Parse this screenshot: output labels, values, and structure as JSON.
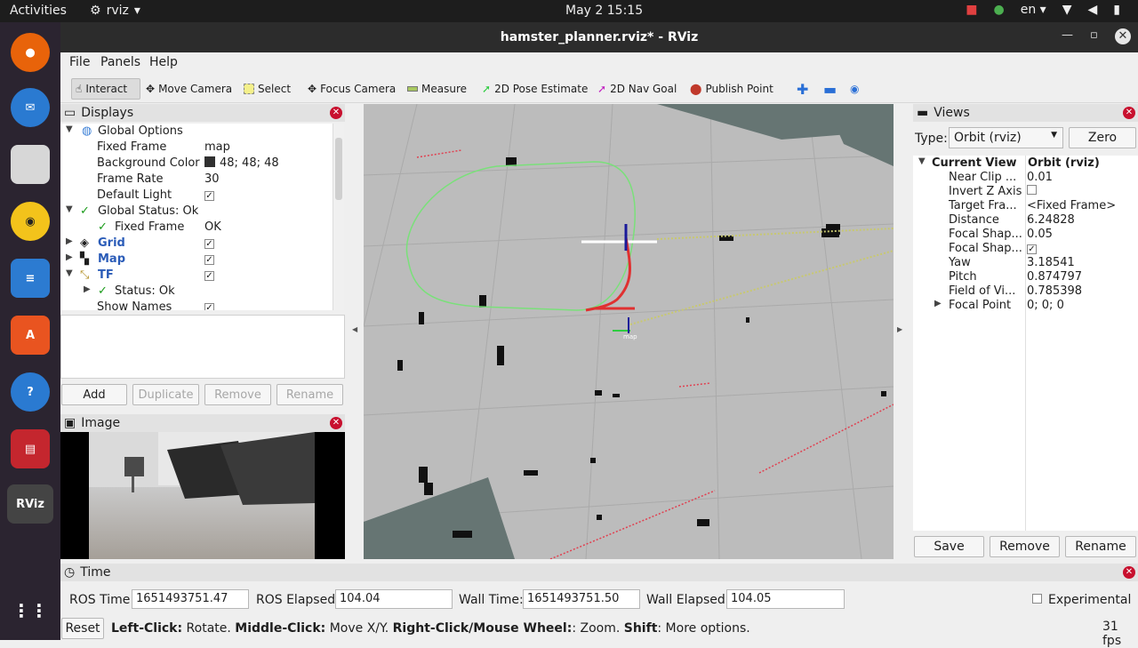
{
  "topbar": {
    "activities": "Activities",
    "app_name": "rviz",
    "clock": "May 2  15:15",
    "lang": "en"
  },
  "window": {
    "title": "hamster_planner.rviz* - RViz"
  },
  "menu": {
    "file": "File",
    "panels": "Panels",
    "help": "Help"
  },
  "toolbar": {
    "interact": "Interact",
    "move_camera": "Move Camera",
    "select": "Select",
    "focus_camera": "Focus Camera",
    "measure": "Measure",
    "pose_estimate": "2D Pose Estimate",
    "nav_goal": "2D Nav Goal",
    "publish_point": "Publish Point"
  },
  "displays": {
    "title": "Displays",
    "rows": [
      {
        "label": "Global Options",
        "value": ""
      },
      {
        "label": "Fixed Frame",
        "value": "map"
      },
      {
        "label": "Background Color",
        "value": "48; 48; 48"
      },
      {
        "label": "Frame Rate",
        "value": "30"
      },
      {
        "label": "Default Light",
        "value": ""
      },
      {
        "label": "Global Status: Ok",
        "value": ""
      },
      {
        "label": "Fixed Frame",
        "value": "OK"
      },
      {
        "label": "Grid",
        "value": ""
      },
      {
        "label": "Map",
        "value": ""
      },
      {
        "label": "TF",
        "value": ""
      },
      {
        "label": "Status: Ok",
        "value": ""
      },
      {
        "label": "Show Names",
        "value": ""
      }
    ],
    "buttons": {
      "add": "Add",
      "duplicate": "Duplicate",
      "remove": "Remove",
      "rename": "Rename"
    }
  },
  "image_panel": {
    "title": "Image"
  },
  "views": {
    "title": "Views",
    "type_label": "Type:",
    "type_value": "Orbit (rviz)",
    "zero": "Zero",
    "header_key": "Current View",
    "header_value": "Orbit (rviz)",
    "rows": [
      {
        "label": "Near Clip ...",
        "value": "0.01"
      },
      {
        "label": "Invert Z Axis",
        "value": ""
      },
      {
        "label": "Target Fra...",
        "value": "<Fixed Frame>"
      },
      {
        "label": "Distance",
        "value": "6.24828"
      },
      {
        "label": "Focal Shap...",
        "value": "0.05"
      },
      {
        "label": "Focal Shap...",
        "value": ""
      },
      {
        "label": "Yaw",
        "value": "3.18541"
      },
      {
        "label": "Pitch",
        "value": "0.874797"
      },
      {
        "label": "Field of Vi...",
        "value": "0.785398"
      },
      {
        "label": "Focal Point",
        "value": "0; 0; 0"
      }
    ],
    "buttons": {
      "save": "Save",
      "remove": "Remove",
      "rename": "Rename"
    }
  },
  "viewport": {
    "frame_label": "map"
  },
  "time": {
    "title": "Time",
    "ros_time_label": "ROS Time:",
    "ros_time": "1651493751.47",
    "ros_elapsed_label": "ROS Elapsed:",
    "ros_elapsed": "104.04",
    "wall_time_label": "Wall Time:",
    "wall_time": "1651493751.50",
    "wall_elapsed_label": "Wall Elapsed:",
    "wall_elapsed": "104.05",
    "experimental": "Experimental"
  },
  "status": {
    "reset": "Reset",
    "hint_left_bold": "Left-Click:",
    "hint_left": " Rotate. ",
    "hint_middle_bold": "Middle-Click:",
    "hint_middle": " Move X/Y. ",
    "hint_right_bold": "Right-Click/Mouse Wheel:",
    "hint_right": ": Zoom. ",
    "hint_shift_bold": "Shift",
    "hint_shift": ": More options.",
    "fps": "31 fps"
  },
  "colors": {
    "background_swatch": "#303030",
    "path": "#7ae07a",
    "accent_red": "#e03030"
  }
}
